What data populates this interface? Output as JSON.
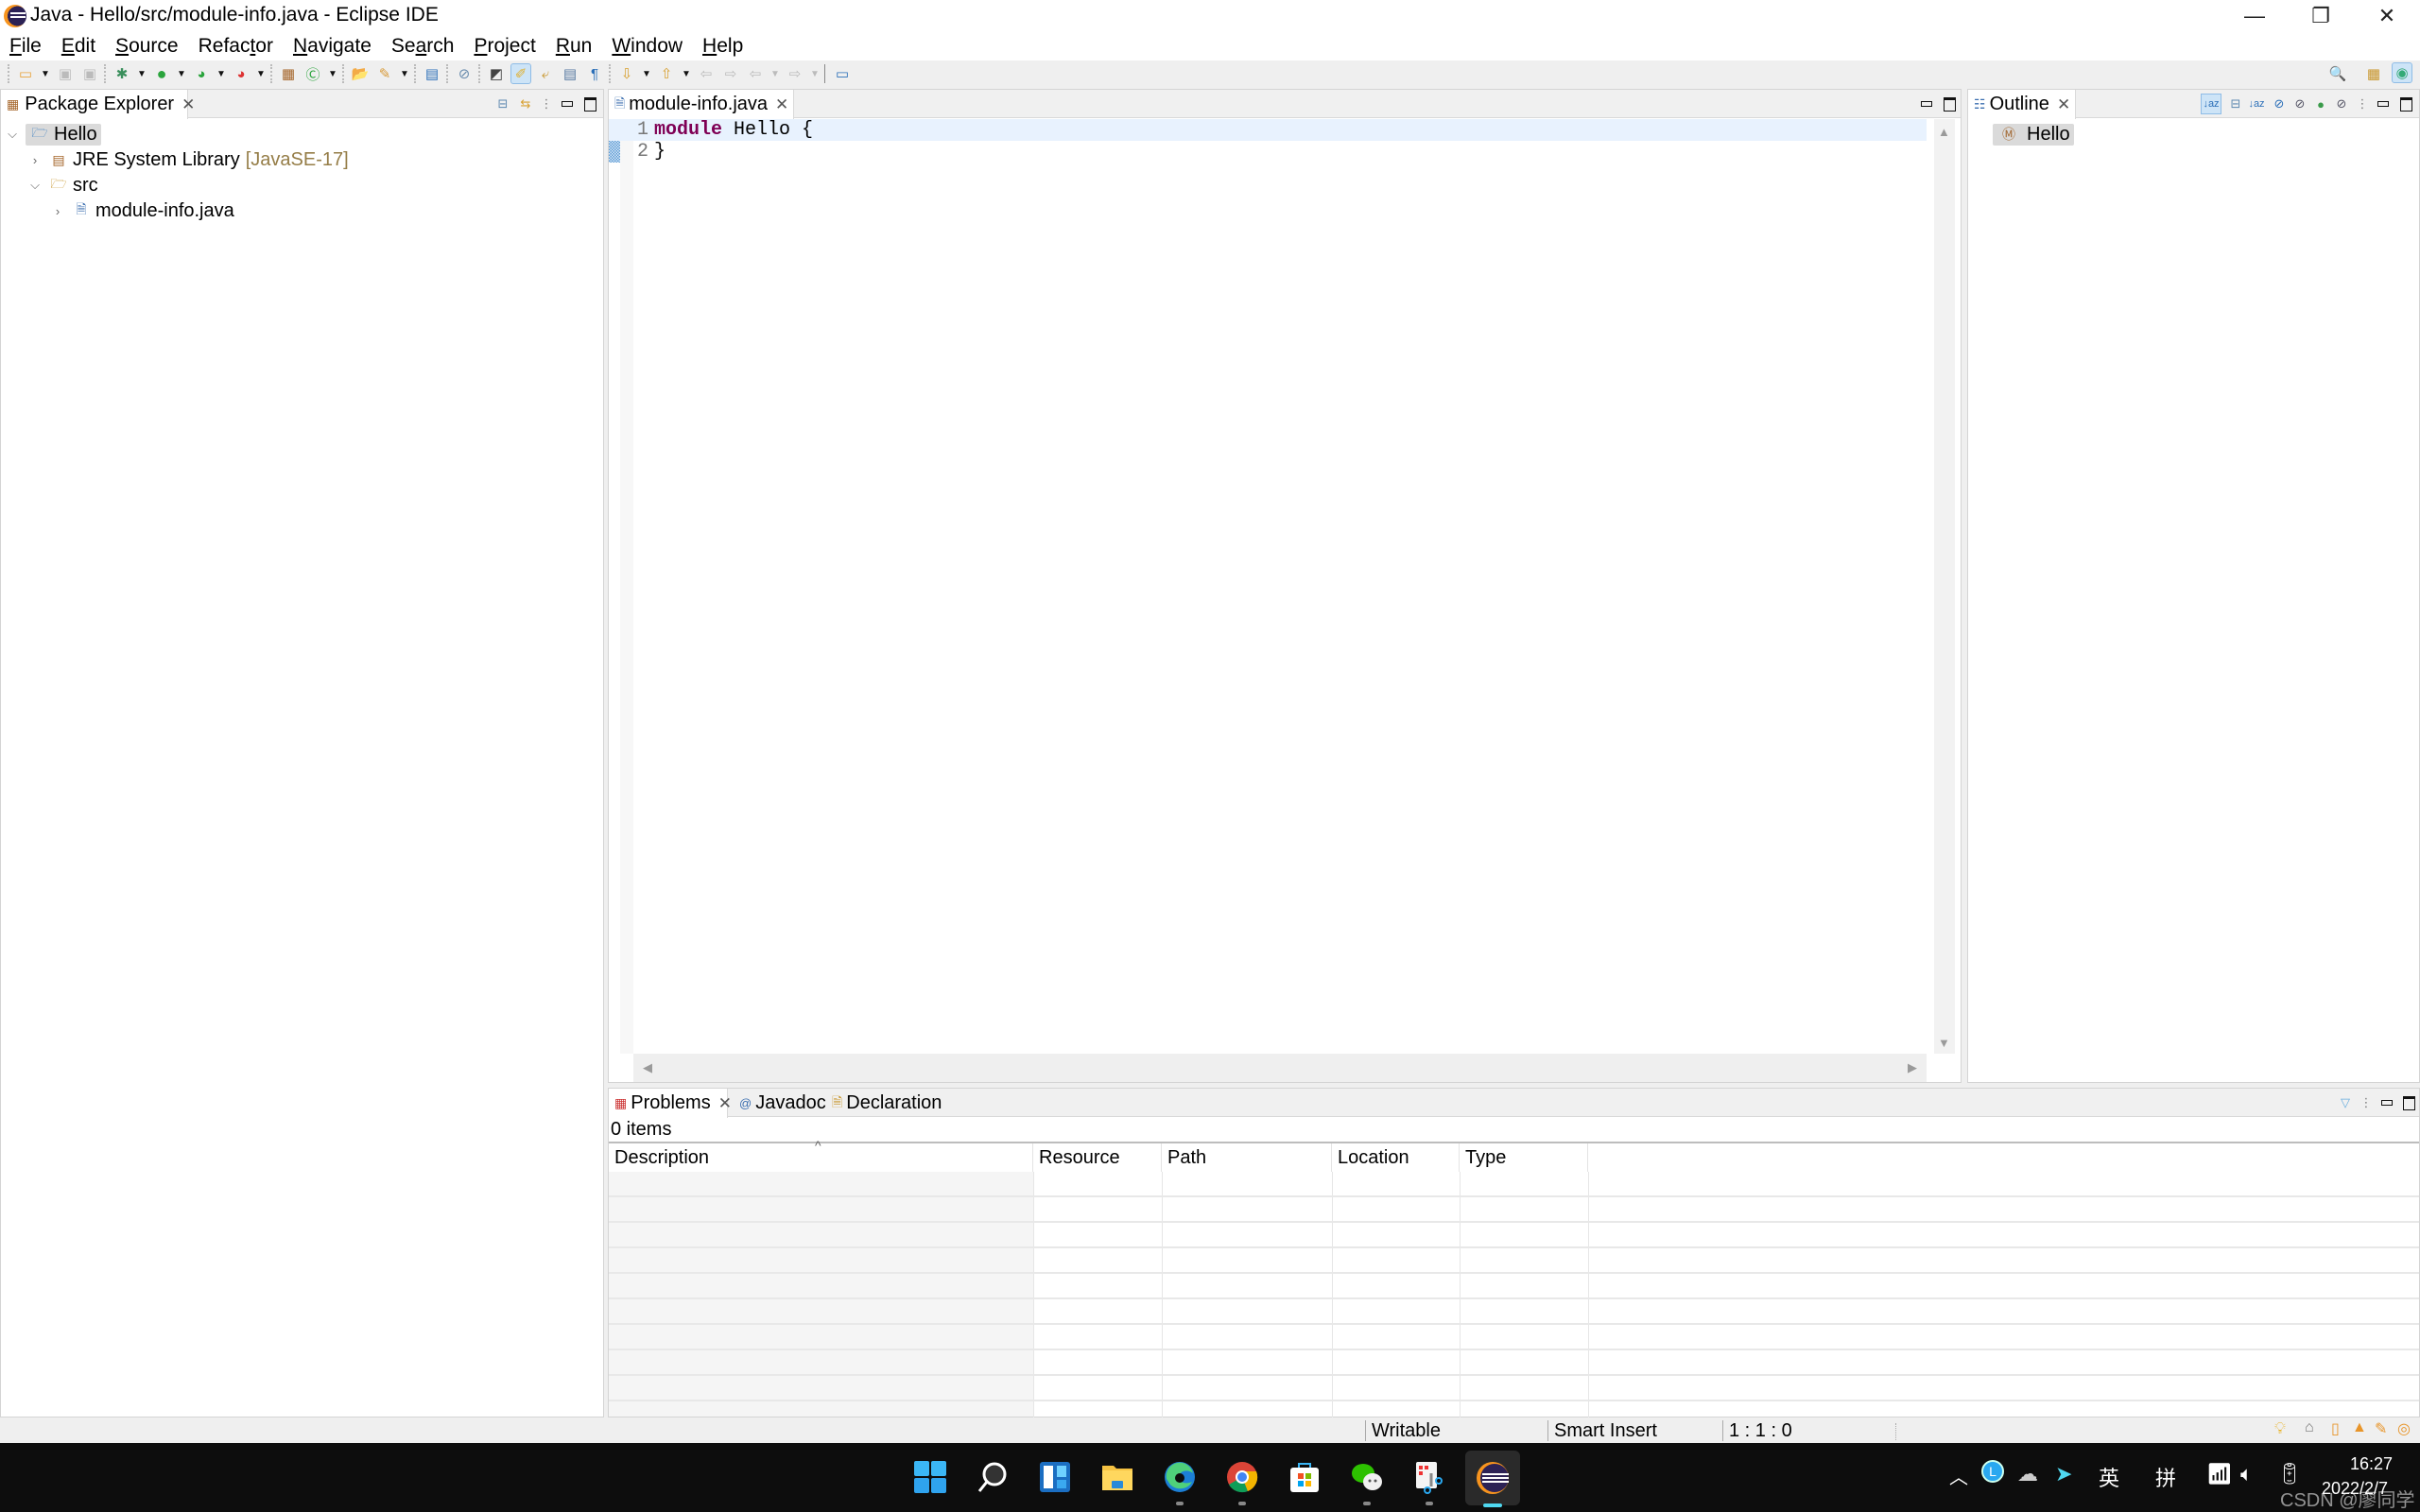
{
  "window": {
    "title": "Java - Hello/src/module-info.java - Eclipse IDE",
    "minimize_glyph": "—",
    "restore_glyph": "❐",
    "close_glyph": "✕"
  },
  "menubar": {
    "items": [
      {
        "mnemonic": "F",
        "rest": "ile"
      },
      {
        "mnemonic": "E",
        "rest": "dit"
      },
      {
        "mnemonic": "S",
        "rest": "ource"
      },
      {
        "pre": "Refac",
        "mnemonic": "t",
        "rest": "or"
      },
      {
        "mnemonic": "N",
        "rest": "avigate"
      },
      {
        "pre": "Se",
        "mnemonic": "a",
        "rest": "rch"
      },
      {
        "mnemonic": "P",
        "rest": "roject"
      },
      {
        "mnemonic": "R",
        "rest": "un"
      },
      {
        "mnemonic": "W",
        "rest": "indow"
      },
      {
        "mnemonic": "H",
        "rest": "elp"
      }
    ]
  },
  "toolbar": {
    "icons": [
      "new-icon",
      "save-icon",
      "save-all-icon",
      "debug-icon",
      "run-icon",
      "coverage-icon",
      "external-tools-icon",
      "new-java-package-icon",
      "new-java-class-icon",
      "open-type-icon",
      "search-icon",
      "terminal-icon",
      "mark-occurrences-icon",
      "toggle-breadcrumb-icon",
      "highlight-icon",
      "block-selection-icon",
      "show-whitespace-icon",
      "next-annotation-icon",
      "previous-annotation-icon",
      "last-edit-icon",
      "back-icon",
      "forward-icon",
      "pin-editor-icon"
    ],
    "quick_access_icon": "search-icon",
    "open_perspective_icon": "open-perspective-icon",
    "java_perspective_icon": "java-perspective-icon"
  },
  "package_explorer": {
    "tab_label": "Package Explorer",
    "tree": [
      {
        "label": "Hello",
        "icon": "java-project-icon",
        "expanded": true,
        "selected": true,
        "depth": 0
      },
      {
        "label": "JRE System Library",
        "decoration": "[JavaSE-17]",
        "icon": "library-icon",
        "expanded": false,
        "depth": 1
      },
      {
        "label": "src",
        "icon": "source-folder-icon",
        "expanded": true,
        "depth": 1
      },
      {
        "label": "module-info.java",
        "icon": "java-file-icon",
        "expanded": false,
        "depth": 2
      }
    ]
  },
  "editor": {
    "tab_label": "module-info.java",
    "lines": [
      {
        "number": "1",
        "keyword": "module",
        "text": " Hello {"
      },
      {
        "number": "2",
        "keyword": "",
        "text": "}"
      }
    ]
  },
  "outline": {
    "tab_label": "Outline",
    "items": [
      {
        "label": "Hello",
        "icon": "module-icon",
        "selected": true
      }
    ]
  },
  "bottom_panel": {
    "tabs": [
      {
        "label": "Problems",
        "icon": "problems-icon",
        "active": true
      },
      {
        "label": "Javadoc",
        "icon": "javadoc-icon",
        "active": false
      },
      {
        "label": "Declaration",
        "icon": "declaration-icon",
        "active": false
      }
    ],
    "summary": "0 items",
    "columns": [
      "Description",
      "Resource",
      "Path",
      "Location",
      "Type"
    ],
    "sort_indicator": "^",
    "rows": []
  },
  "statusbar": {
    "writable": "Writable",
    "insert_mode": "Smart Insert",
    "position": "1 : 1 : 0"
  },
  "taskbar": {
    "apps": [
      "start-icon",
      "search-icon",
      "widgets-icon",
      "file-explorer-icon",
      "edge-icon",
      "chrome-icon",
      "store-icon",
      "wechat-icon",
      "snipping-tool-icon",
      "eclipse-icon"
    ],
    "tray": {
      "ime_lang": "英",
      "ime_mode": "拼",
      "time": "16:27",
      "date": "2022/2/7"
    },
    "watermark": "CSDN @廖同学"
  }
}
